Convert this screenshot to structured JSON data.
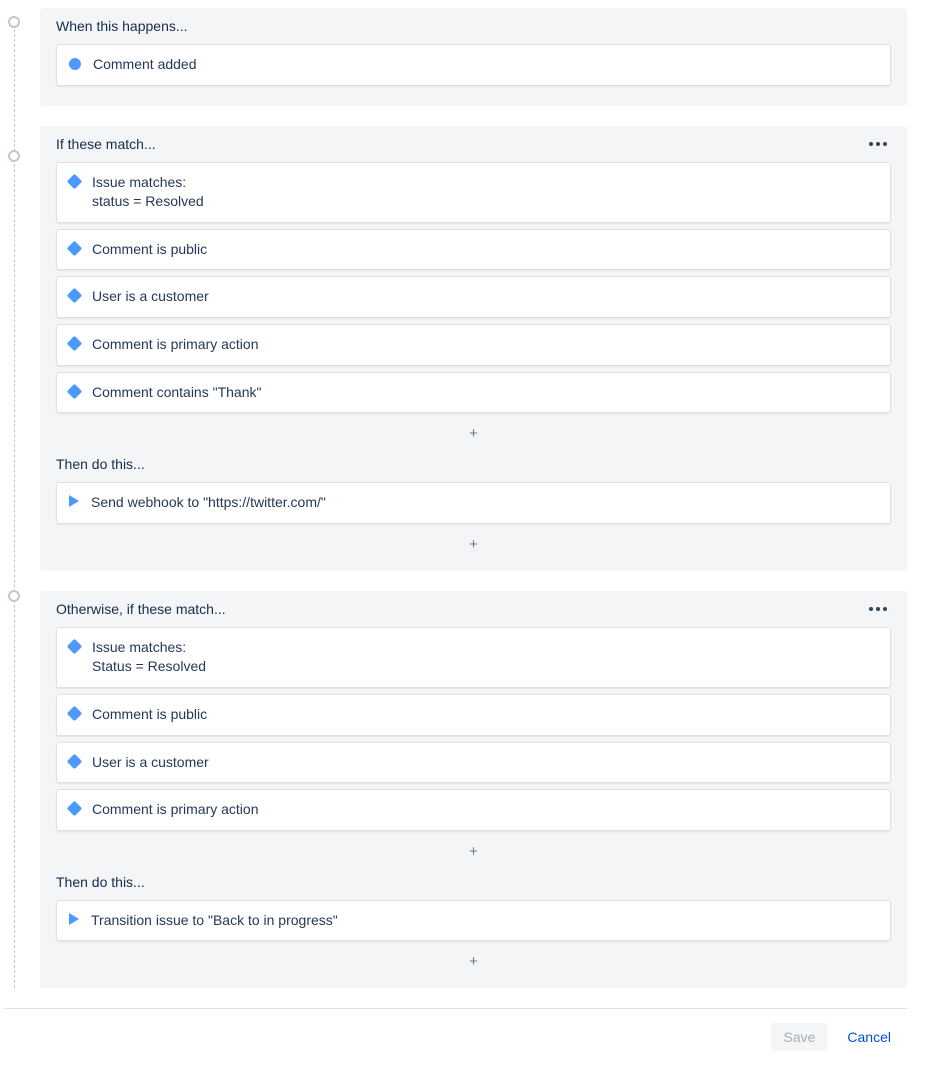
{
  "trigger": {
    "title": "When this happens...",
    "item": "Comment added"
  },
  "branch1": {
    "title": "If these match...",
    "conditions": [
      {
        "line1": "Issue matches:",
        "line2": "status = Resolved"
      },
      {
        "line1": "Comment is public"
      },
      {
        "line1": "User is a customer"
      },
      {
        "line1": "Comment is primary action"
      },
      {
        "line1": "Comment contains \"Thank\""
      }
    ],
    "then_title": "Then do this...",
    "action": "Send webhook to \"https://twitter.com/\""
  },
  "branch2": {
    "title": "Otherwise, if these match...",
    "conditions": [
      {
        "line1": "Issue matches:",
        "line2": "Status = Resolved"
      },
      {
        "line1": "Comment is public"
      },
      {
        "line1": "User is a customer"
      },
      {
        "line1": "Comment is primary action"
      }
    ],
    "then_title": "Then do this...",
    "action": "Transition issue to \"Back to in progress\""
  },
  "plus": "+",
  "footer": {
    "save": "Save",
    "cancel": "Cancel"
  }
}
